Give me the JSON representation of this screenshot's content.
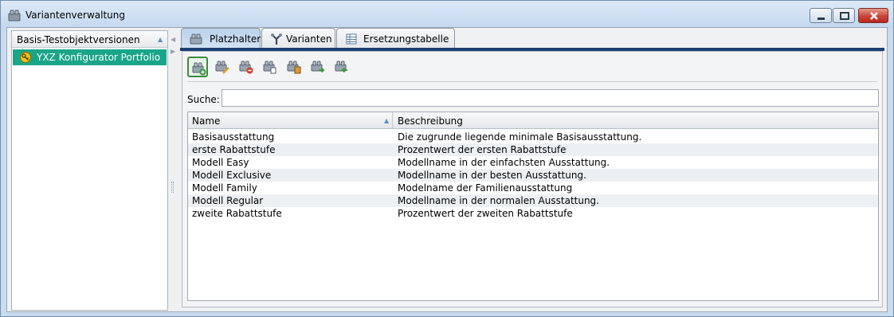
{
  "window": {
    "title": "Variantenverwaltung",
    "icon": "lego-brick-icon"
  },
  "left_panel": {
    "header": "Basis-Testobjektversionen",
    "items": [
      {
        "label": "YXZ Konfigurator Portfolio",
        "icon": "key-icon",
        "selected": true
      }
    ]
  },
  "tabs": [
    {
      "label": "Platzhalter",
      "icon": "lego-brick-icon",
      "active": true
    },
    {
      "label": "Varianten",
      "icon": "fork-icon",
      "active": false
    },
    {
      "label": "Ersetzungstabelle",
      "icon": "table-icon",
      "active": false
    }
  ],
  "toolbar": {
    "buttons": [
      {
        "name": "add-placeholder-button",
        "icon": "brick-add-icon",
        "selected": true
      },
      {
        "name": "edit-placeholder-button",
        "icon": "brick-edit-icon"
      },
      {
        "name": "delete-placeholder-button",
        "icon": "brick-delete-icon"
      },
      {
        "name": "copy-placeholder-button",
        "icon": "brick-copy-icon"
      },
      {
        "name": "paste-placeholder-button",
        "icon": "brick-paste-icon"
      },
      {
        "name": "import-placeholder-button",
        "icon": "brick-import-icon"
      },
      {
        "name": "export-placeholder-button",
        "icon": "brick-export-icon"
      }
    ]
  },
  "search": {
    "label": "Suche:",
    "value": ""
  },
  "table": {
    "columns": [
      "Name",
      "Beschreibung"
    ],
    "rows": [
      [
        "Basisausstattung",
        "Die zugrunde liegende minimale Basisausstattung."
      ],
      [
        "erste Rabattstufe",
        "Prozentwert der ersten Rabattstufe"
      ],
      [
        "Modell Easy",
        "Modellname in der einfachsten Ausstattung."
      ],
      [
        "Modell Exclusive",
        "Modellname in der besten Ausstattung."
      ],
      [
        "Modell Family",
        "Modelname der Familienausstattung"
      ],
      [
        "Modell Regular",
        "Modellname in der normalen Ausstattung."
      ],
      [
        "zweite Rabattstufe",
        "Prozentwert der zweiten Rabattstufe"
      ]
    ]
  },
  "colors": {
    "selection": "#1aa589",
    "tab_rule": "#1d3f73",
    "accent_green": "#3d8a3d"
  }
}
